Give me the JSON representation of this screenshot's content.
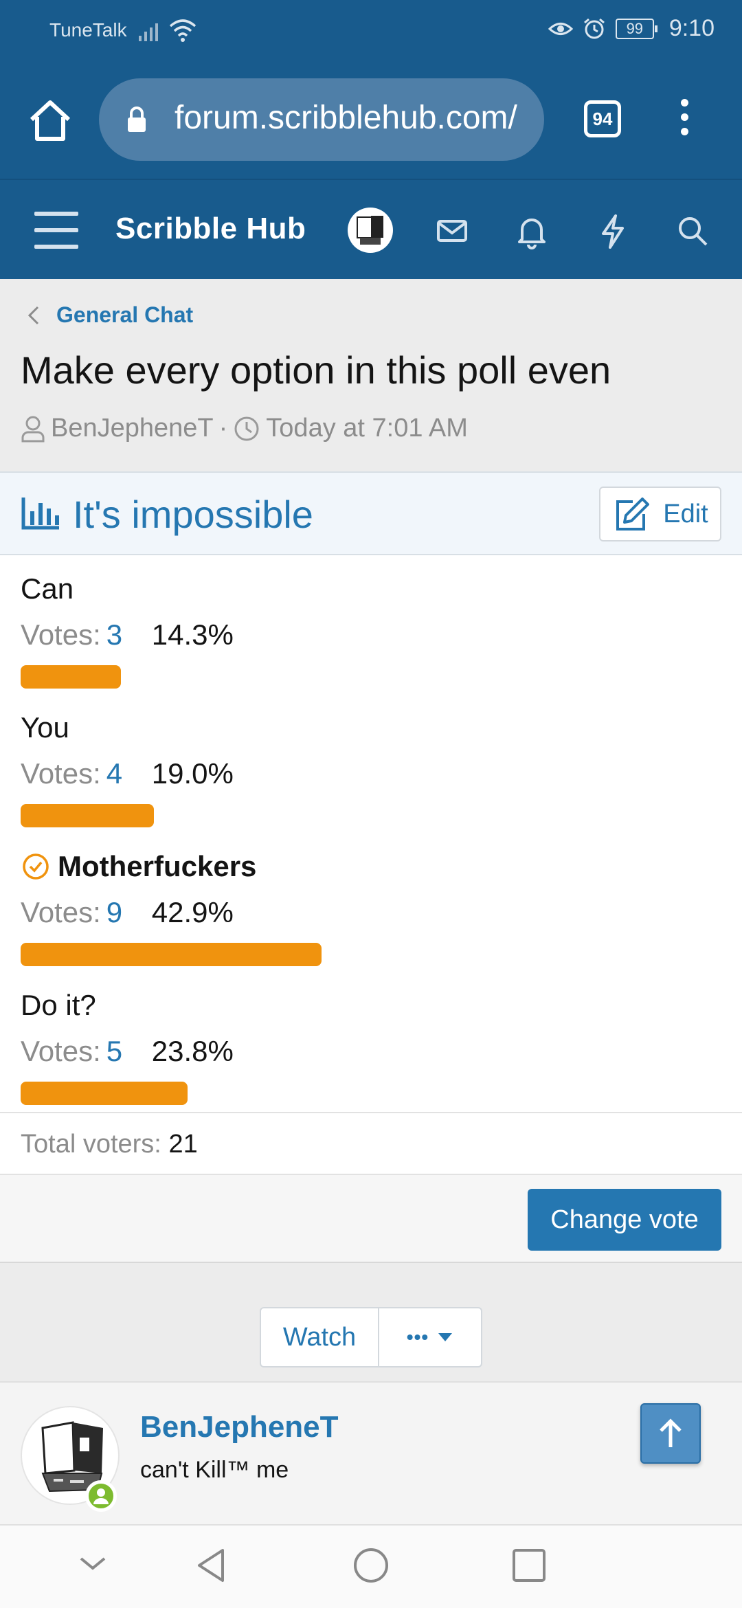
{
  "status_bar": {
    "carrier": "TuneTalk",
    "battery": "99",
    "time": "9:10"
  },
  "browser": {
    "url": "forum.scribblehub.com/",
    "tab_count": "94"
  },
  "forum_nav": {
    "brand": "Scribble Hub"
  },
  "breadcrumb": {
    "label": "General Chat"
  },
  "thread": {
    "title": "Make every option in this poll even",
    "author": "BenJepheneT",
    "separator": "·",
    "time": "Today at 7:01 AM"
  },
  "poll": {
    "title": "It's impossible",
    "edit_label": "Edit",
    "votes_label": "Votes:",
    "options": [
      {
        "label": "Can",
        "votes": "3",
        "percent": "14.3%",
        "fraction": 0.143
      },
      {
        "label": "You",
        "votes": "4",
        "percent": "19.0%",
        "fraction": 0.19
      },
      {
        "label": "Motherfuckers",
        "votes": "9",
        "percent": "42.9%",
        "fraction": 0.429,
        "chosen": true
      },
      {
        "label": "Do it?",
        "votes": "5",
        "percent": "23.8%",
        "fraction": 0.238
      }
    ],
    "total_label": "Total voters:",
    "total": "21",
    "change_vote_label": "Change vote"
  },
  "thread_actions": {
    "watch_label": "Watch",
    "more_label": "•••"
  },
  "post": {
    "username": "BenJepheneT",
    "user_title": "can't Kill™ me"
  },
  "colors": {
    "accent": "#2577b1",
    "header": "#185b8d",
    "bar": "#f0930e",
    "online": "#7dbb2f"
  },
  "icons": [
    "home-icon",
    "lock-icon",
    "menu-icon",
    "mail-icon",
    "bell-icon",
    "lightning-icon",
    "search-icon",
    "chevron-left-icon",
    "user-icon",
    "clock-icon",
    "poll-chart-icon",
    "edit-icon",
    "check-circle-icon",
    "caret-down-icon",
    "arrow-up-icon"
  ]
}
